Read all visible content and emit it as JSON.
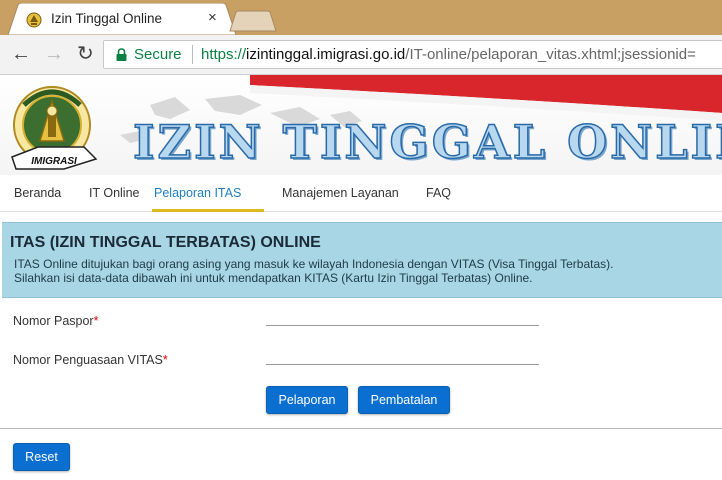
{
  "browser": {
    "tab_title": "Izin Tinggal Online",
    "tab_close": "×",
    "secure_label": "Secure",
    "url_scheme": "https://",
    "url_host": "izintinggal.imigrasi.go.id",
    "url_path": "/IT-online/pelaporan_vitas.xhtml;jsessionid=",
    "back_glyph": "←",
    "forward_glyph": "→",
    "reload_glyph": "↻"
  },
  "banner": {
    "title": "IZIN TINGGAL ONLINE",
    "logo_ribbon": "IMIGRASI"
  },
  "menu": {
    "items": [
      "Beranda",
      "IT Online",
      "Pelaporan ITAS",
      "Manajemen Layanan",
      "FAQ"
    ],
    "active": "Pelaporan ITAS"
  },
  "info": {
    "title": "ITAS (IZIN TINGGAL TERBATAS) ONLINE",
    "line1": "ITAS Online ditujukan bagi orang asing yang masuk ke wilayah Indonesia dengan VITAS (Visa Tinggal Terbatas).",
    "line2": "Silahkan isi data-data dibawah ini untuk mendapatkan KITAS (Kartu Izin Tinggal Terbatas) Online."
  },
  "form": {
    "passport_label": "Nomor Paspor",
    "passport_value": "",
    "vitas_label": "Nomor Penguasaan VITAS",
    "vitas_value": "",
    "required_mark": "*",
    "submit_label": "Pelaporan",
    "cancel_label": "Pembatalan",
    "reset_label": "Reset"
  },
  "colors": {
    "tab_strip": "#c8a064",
    "info_panel": "#a9d6e5",
    "primary_button": "#0a6fd0",
    "active_menu": "#1e7fc0",
    "menu_underline": "#e0b820",
    "secure_green": "#0b8043"
  },
  "icons": {
    "favicon": "immigration-emblem-icon",
    "lock": "lock-icon",
    "logo": "immigration-logo"
  }
}
